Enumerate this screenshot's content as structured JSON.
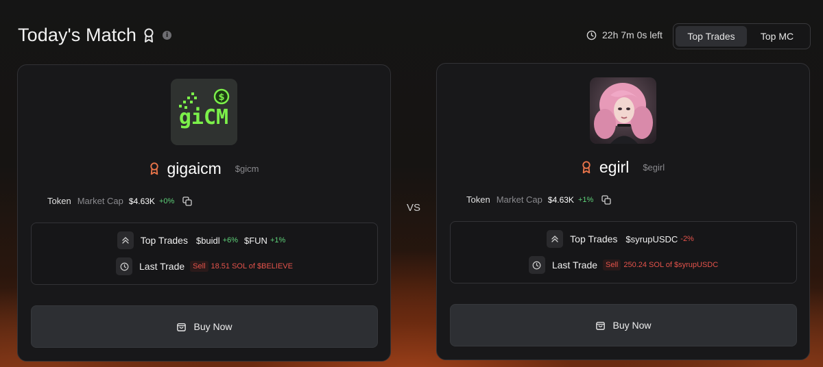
{
  "header": {
    "title": "Today's Match",
    "timer": "22h 7m 0s left",
    "tabs": [
      {
        "label": "Top Trades",
        "active": true
      },
      {
        "label": "Top MC",
        "active": false
      }
    ]
  },
  "vs_label": "VS",
  "cards": [
    {
      "name": "gigaicm",
      "ticker": "$gicm",
      "logo_text": "giCM",
      "token_label": "Token",
      "market_cap_label": "Market Cap",
      "market_cap": "$4.63K",
      "market_cap_change": "+0%",
      "top_trades_label": "Top Trades",
      "top_trades": [
        {
          "ticker": "$buidl",
          "change": "+6%",
          "direction": "up"
        },
        {
          "ticker": "$FUN",
          "change": "+1%",
          "direction": "up"
        }
      ],
      "last_trade_label": "Last Trade",
      "last_trade_type": "Sell",
      "last_trade_desc": "18.51 SOL of $BELIEVE",
      "buy_label": "Buy Now"
    },
    {
      "name": "egirl",
      "ticker": "$egirl",
      "token_label": "Token",
      "market_cap_label": "Market Cap",
      "market_cap": "$4.63K",
      "market_cap_change": "+1%",
      "top_trades_label": "Top Trades",
      "top_trades": [
        {
          "ticker": "$syrupUSDC",
          "change": "-2%",
          "direction": "down"
        }
      ],
      "last_trade_label": "Last Trade",
      "last_trade_type": "Sell",
      "last_trade_desc": "250.24 SOL of $syrupUSDC",
      "buy_label": "Buy Now"
    }
  ],
  "colors": {
    "positive": "#5fd37a",
    "negative": "#e5534b",
    "medal": "#e8744a",
    "accent_green": "#7cf04a"
  }
}
